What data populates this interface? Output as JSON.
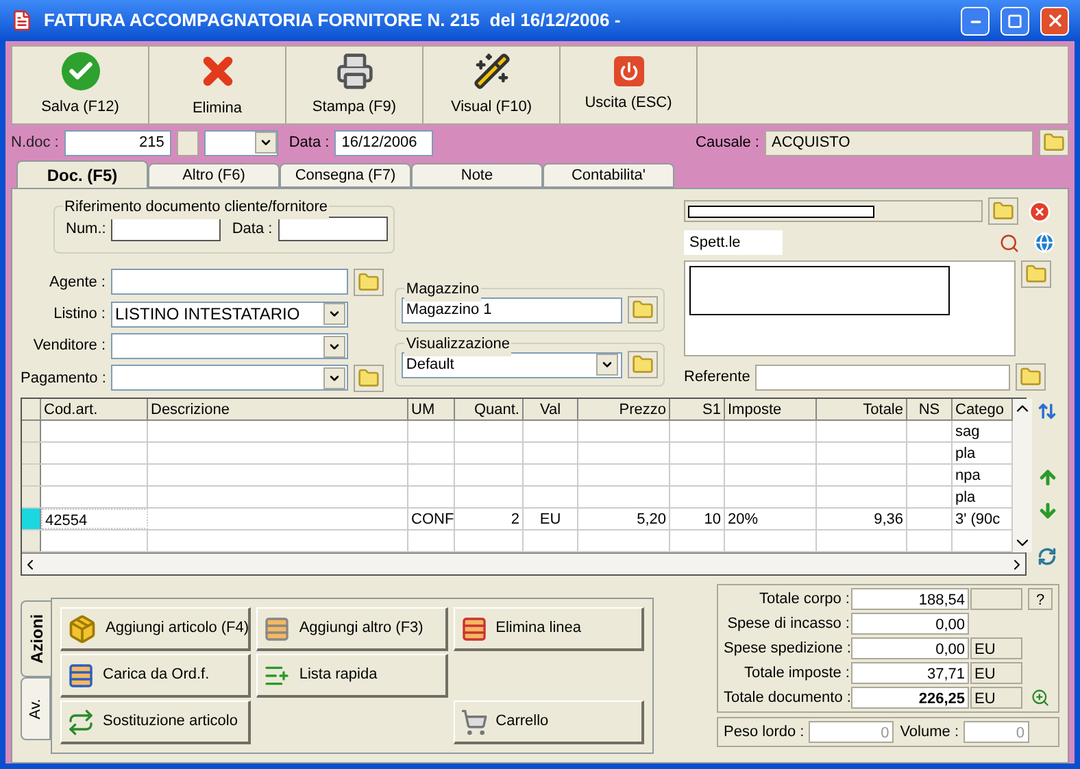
{
  "window": {
    "title": "FATTURA ACCOMPAGNATORIA FORNITORE N. 215  del 16/12/2006 -"
  },
  "toolbar": [
    {
      "label": "Salva (F12)"
    },
    {
      "label": "Elimina"
    },
    {
      "label": "Stampa (F9)"
    },
    {
      "label": "Visual (F10)"
    },
    {
      "label": "Uscita (ESC)"
    }
  ],
  "header": {
    "ndoc_label": "N.doc :",
    "ndoc_value": "215",
    "data_label": "Data :",
    "data_value": "16/12/2006",
    "causale_label": "Causale :",
    "causale_value": "ACQUISTO"
  },
  "tabs": [
    {
      "label": "Doc. (F5)",
      "selected": true
    },
    {
      "label": "Altro (F6)",
      "selected": false
    },
    {
      "label": "Consegna (F7)",
      "selected": false
    },
    {
      "label": "Note",
      "selected": false
    },
    {
      "label": "Contabilita'",
      "selected": false
    }
  ],
  "riferimento": {
    "title": "Riferimento documento cliente/fornitore",
    "num_label": "Num.:",
    "data_label": "Data :"
  },
  "fields": [
    {
      "label": "Agente :",
      "kind": "folder"
    },
    {
      "label": "Listino :",
      "value": "LISTINO INTESTATARIO",
      "kind": "dropdown"
    },
    {
      "label": "Venditore :",
      "kind": "dropdown"
    },
    {
      "label": "Pagamento :",
      "kind": "dropdown-folder"
    }
  ],
  "magazzino": {
    "title": "Magazzino",
    "value": "Magazzino 1"
  },
  "visualizzazione": {
    "title": "Visualizzazione",
    "value": "Default"
  },
  "cliente": {
    "salutation": "Spett.le",
    "referente_label": "Referente"
  },
  "table": {
    "columns": [
      "Cod.art.",
      "Descrizione",
      "UM",
      "Quant.",
      "Val",
      "Prezzo",
      "S1",
      "Imposte",
      "Totale",
      "NS",
      "Catego"
    ],
    "rows": [
      {
        "selected": false,
        "cells": [
          "",
          "",
          "",
          "",
          "",
          "",
          "",
          "",
          "",
          "",
          "sag"
        ]
      },
      {
        "selected": false,
        "cells": [
          "",
          "",
          "",
          "",
          "",
          "",
          "",
          "",
          "",
          "",
          "pla"
        ]
      },
      {
        "selected": false,
        "cells": [
          "",
          "",
          "",
          "",
          "",
          "",
          "",
          "",
          "",
          "",
          "npa"
        ]
      },
      {
        "selected": false,
        "cells": [
          "",
          "",
          "",
          "",
          "",
          "",
          "",
          "",
          "",
          "",
          "pla"
        ]
      },
      {
        "selected": true,
        "cells": [
          "42554",
          "",
          "CONF",
          "2",
          "EU",
          "5,20",
          "10",
          "20%",
          "9,36",
          "",
          "3' (90c"
        ]
      },
      {
        "selected": false,
        "cells": [
          "",
          "",
          "",
          "",
          "",
          "",
          "",
          "",
          "",
          "",
          ""
        ]
      }
    ]
  },
  "actions": {
    "side_tabs": [
      {
        "label": "Azioni",
        "selected": true
      },
      {
        "label": "Av.",
        "selected": false
      }
    ],
    "buttons": [
      {
        "label": "Aggiungi articolo (F4)",
        "kind": "box-add"
      },
      {
        "label": "Aggiungi altro (F3)",
        "kind": "grid-add"
      },
      {
        "label": "Elimina linea",
        "kind": "grid-delete"
      },
      {
        "label": "Carica da Ord.f.",
        "kind": "grid-check"
      },
      {
        "label": "Lista rapida",
        "kind": "list-add"
      },
      {
        "kind": "empty"
      },
      {
        "label": "Sostituzione articolo",
        "kind": "swap"
      },
      {
        "kind": "empty"
      },
      {
        "label": "Carrello",
        "kind": "cart"
      }
    ]
  },
  "totals": [
    {
      "label": "Totale corpo :",
      "value": "188,54",
      "kind": "help"
    },
    {
      "label": "Spese di incasso :",
      "value": "0,00",
      "kind": "plain"
    },
    {
      "label": "Spese spedizione :",
      "value": "0,00",
      "unit": "EU",
      "kind": "plain"
    },
    {
      "label": "Totale imposte :",
      "value": "37,71",
      "unit": "EU",
      "kind": "plain"
    },
    {
      "label": "Totale documento :",
      "value": "226,25",
      "unit": "EU",
      "kind": "zoom",
      "bold": true
    }
  ],
  "help_button": "?",
  "peso": {
    "label": "Peso lordo :",
    "value": "0"
  },
  "volume": {
    "label": "Volume :",
    "value": "0"
  }
}
